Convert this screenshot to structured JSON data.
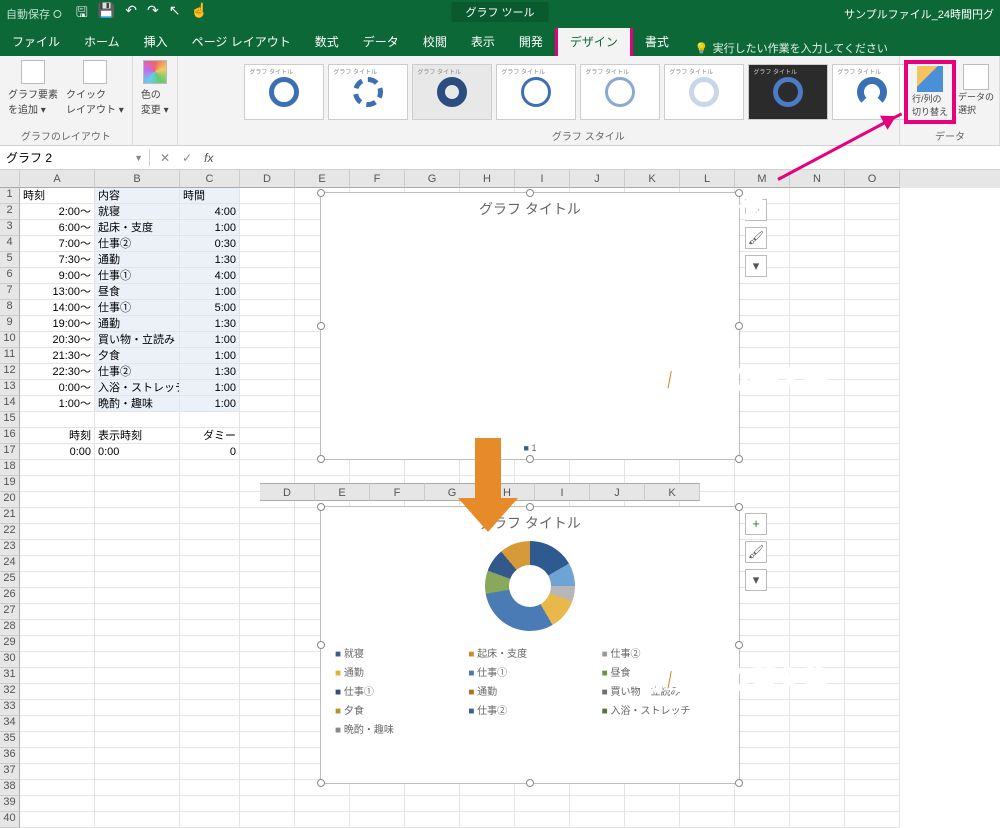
{
  "titlebar": {
    "autosave": "自動保存 ⭘",
    "tool_context": "グラフ ツール",
    "filename": "サンプルファイル_24時間円グ"
  },
  "tabs": {
    "file": "ファイル",
    "home": "ホーム",
    "insert": "挿入",
    "pagelayout": "ページ レイアウト",
    "formulas": "数式",
    "data": "データ",
    "review": "校閲",
    "view": "表示",
    "dev": "開発",
    "design": "デザイン",
    "format": "書式",
    "tell": "実行したい作業を入力してください"
  },
  "ribbon": {
    "layout_group": "グラフのレイアウト",
    "add_element": "グラフ要素\nを追加 ▾",
    "quick_layout": "クイック\nレイアウト ▾",
    "change_colors": "色の\n変更 ▾",
    "styles_group": "グラフ スタイル",
    "style_label": "グラフ タイトル",
    "swap": "行/列の\n切り替え",
    "select_data": "データの\n選択",
    "data_group": "データ"
  },
  "namebox": "グラフ 2",
  "columns": [
    "",
    "A",
    "B",
    "C",
    "D",
    "E",
    "F",
    "G",
    "H",
    "I",
    "J",
    "K",
    "L",
    "M",
    "N",
    "O"
  ],
  "columns2": [
    "D",
    "E",
    "F",
    "G",
    "H",
    "I",
    "J",
    "K"
  ],
  "headers": {
    "a": "時刻",
    "b": "内容",
    "c": "時間"
  },
  "rows": [
    {
      "n": 1
    },
    {
      "n": 2,
      "a": "2:00～",
      "b": "就寝",
      "c": "4:00"
    },
    {
      "n": 3,
      "a": "6:00～",
      "b": "起床・支度",
      "c": "1:00"
    },
    {
      "n": 4,
      "a": "7:00～",
      "b": "仕事②",
      "c": "0:30"
    },
    {
      "n": 5,
      "a": "7:30～",
      "b": "通勤",
      "c": "1:30"
    },
    {
      "n": 6,
      "a": "9:00～",
      "b": "仕事①",
      "c": "4:00"
    },
    {
      "n": 7,
      "a": "13:00～",
      "b": "昼食",
      "c": "1:00"
    },
    {
      "n": 8,
      "a": "14:00～",
      "b": "仕事①",
      "c": "5:00"
    },
    {
      "n": 9,
      "a": "19:00～",
      "b": "通勤",
      "c": "1:30"
    },
    {
      "n": 10,
      "a": "20:30～",
      "b": "買い物・立読み",
      "c": "1:00"
    },
    {
      "n": 11,
      "a": "21:30～",
      "b": "夕食",
      "c": "1:00"
    },
    {
      "n": 12,
      "a": "22:30～",
      "b": "仕事②",
      "c": "1:30"
    },
    {
      "n": 13,
      "a": "0:00～",
      "b": "入浴・ストレッチ",
      "c": "1:00"
    },
    {
      "n": 14,
      "a": "1:00～",
      "b": "晩酌・趣味",
      "c": "1:00"
    },
    {
      "n": 15
    },
    {
      "n": 16,
      "a": "時刻",
      "b": "表示時刻",
      "c": "ダミー"
    },
    {
      "n": 17,
      "a": "0:00",
      "b": "0:00",
      "c": "0"
    }
  ],
  "chart": {
    "title": "グラフ タイトル",
    "mini_legend": "1",
    "legend": [
      "就寝",
      "起床・支度",
      "仕事②",
      "通勤",
      "仕事①",
      "昼食",
      "仕事①",
      "通勤",
      "買い物・立読み",
      "夕食",
      "仕事②",
      "入浴・ストレッチ",
      "晩酌・趣味"
    ]
  },
  "anno": {
    "click": "クリック",
    "before": "行/列切り替え前",
    "after": "行/列切り替え後"
  },
  "chart_data": {
    "type": "pie",
    "title": "グラフ タイトル",
    "series": [
      {
        "name": "就寝",
        "value": 4.0
      },
      {
        "name": "起床・支度",
        "value": 1.0
      },
      {
        "name": "仕事②",
        "value": 0.5
      },
      {
        "name": "通勤",
        "value": 1.5
      },
      {
        "name": "仕事①",
        "value": 4.0
      },
      {
        "name": "昼食",
        "value": 1.0
      },
      {
        "name": "仕事①",
        "value": 5.0
      },
      {
        "name": "通勤",
        "value": 1.5
      },
      {
        "name": "買い物・立読み",
        "value": 1.0
      },
      {
        "name": "夕食",
        "value": 1.0
      },
      {
        "name": "仕事②",
        "value": 1.5
      },
      {
        "name": "入浴・ストレッチ",
        "value": 1.0
      },
      {
        "name": "晩酌・趣味",
        "value": 1.0
      }
    ]
  }
}
